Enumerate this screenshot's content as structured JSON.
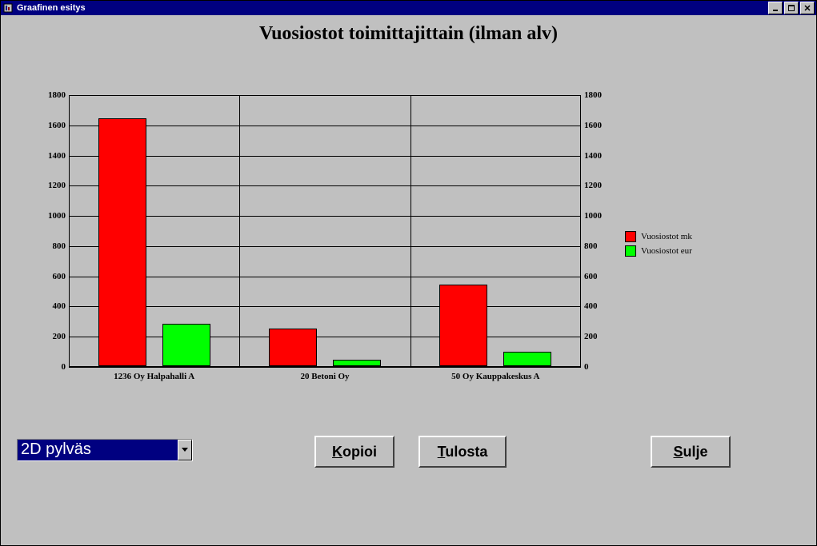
{
  "window": {
    "title": "Graafinen esitys"
  },
  "chart": {
    "title": "Vuosiostot toimittajittain (ilman alv)"
  },
  "chart_data": {
    "type": "bar",
    "title": "Vuosiostot toimittajittain (ilman alv)",
    "categories": [
      "1236 Oy Halpahalli A",
      "20 Betoni Oy",
      "50 Oy Kauppakeskus A"
    ],
    "series": [
      {
        "name": "Vuosiostot mk",
        "color": "#ff0000",
        "values": [
          1640,
          250,
          540
        ]
      },
      {
        "name": "Vuosiostot eur",
        "color": "#00ff00",
        "values": [
          280,
          40,
          95
        ]
      }
    ],
    "ylim": [
      0,
      1800
    ],
    "y_ticks": [
      0,
      200,
      400,
      600,
      800,
      1000,
      1200,
      1400,
      1600,
      1800
    ],
    "xlabel": "",
    "ylabel": ""
  },
  "legend": {
    "s0": "Vuosiostot mk",
    "s1": "Vuosiostot eur"
  },
  "controls": {
    "chart_type_selected": "2D pylväs",
    "copy_label": "Kopioi",
    "print_label": "Tulosta",
    "close_label": "Sulje"
  }
}
